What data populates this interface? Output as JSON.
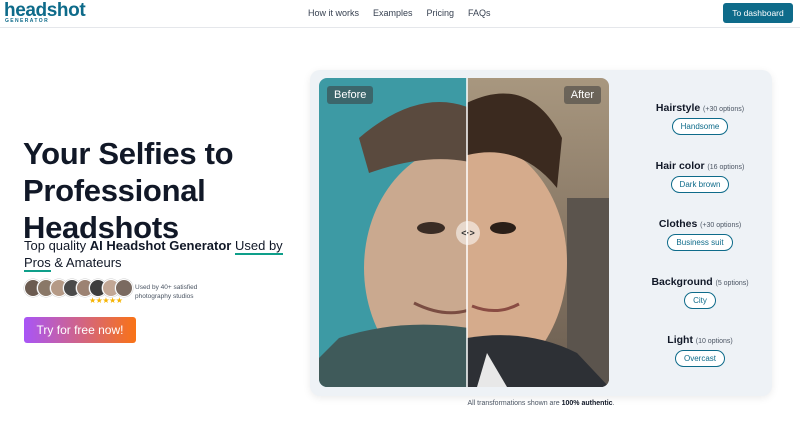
{
  "nav": {
    "logo_word": "headshot",
    "logo_sub": "GENERATOR",
    "links": [
      "How it works",
      "Examples",
      "Pricing",
      "FAQs"
    ],
    "dashboard_button": "To dashboard"
  },
  "hero": {
    "title_lines": [
      "Your Selfies to",
      "Professional",
      "Headshots"
    ],
    "subtitle_pre": "Top quality ",
    "subtitle_bold": "AI Headshot Generator",
    "subtitle_mid": " ",
    "subtitle_underline_1": "Used by",
    "subtitle_underline_2": "Pros",
    "subtitle_post": " & Amateurs",
    "rating_stars": "★★★★★",
    "used_by_text": "Used by 40+ satisfied photography studios",
    "cta_label": "Try for free now!"
  },
  "comparison": {
    "before_label": "Before",
    "after_label": "After",
    "handle_glyph": "<·>"
  },
  "options": [
    {
      "name": "Hairstyle",
      "count": "(+30 options)",
      "value": "Handsome"
    },
    {
      "name": "Hair color",
      "count": "(16 options)",
      "value": "Dark brown"
    },
    {
      "name": "Clothes",
      "count": "(+30 options)",
      "value": "Business suit"
    },
    {
      "name": "Background",
      "count": "(5 options)",
      "value": "City"
    },
    {
      "name": "Light",
      "count": "(10 options)",
      "value": "Overcast"
    }
  ],
  "footnote": {
    "pre": "All transformations shown are ",
    "bold": "100% authentic",
    "post": "."
  },
  "colors": {
    "brand": "#0e6b8a",
    "cta_start": "#a855f7",
    "cta_end": "#f97316",
    "star": "#f5b301"
  }
}
